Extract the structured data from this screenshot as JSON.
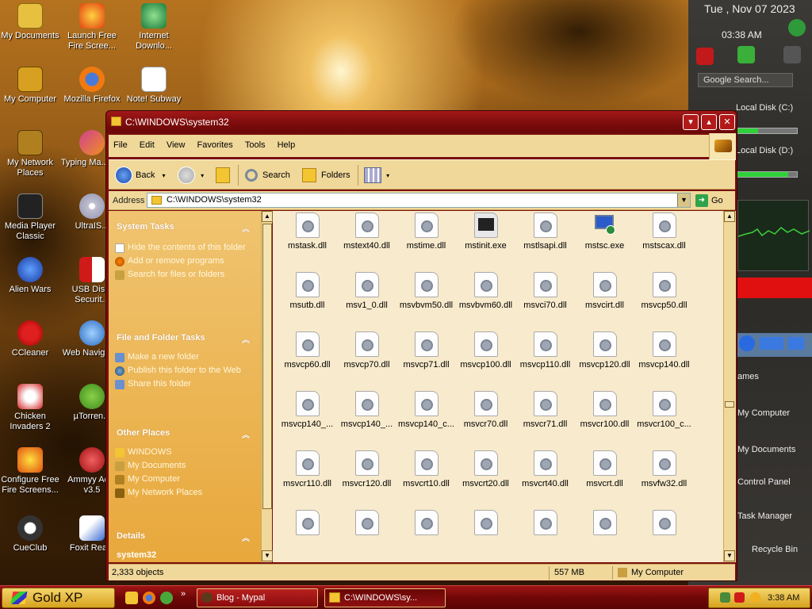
{
  "desktop_icons": [
    {
      "label": "My Documents"
    },
    {
      "label": "Launch Free Fire Scree..."
    },
    {
      "label": "Internet Downlo..."
    },
    {
      "label": "My Computer"
    },
    {
      "label": "Mozilla Firefox"
    },
    {
      "label": "Note! Subway"
    },
    {
      "label": "My Network Places"
    },
    {
      "label": "Typing Ma... 7.0"
    },
    {
      "label": "Media Player Classic"
    },
    {
      "label": "UltraIS..."
    },
    {
      "label": "Alien Wars"
    },
    {
      "label": "USB Dis... Securit..."
    },
    {
      "label": "CCleaner"
    },
    {
      "label": "Web Navigati..."
    },
    {
      "label": "Chicken Invaders 2"
    },
    {
      "label": "µTorren..."
    },
    {
      "label": "Configure Free Fire Screens..."
    },
    {
      "label": "Ammyy Ad... v3.5"
    },
    {
      "label": "CueClub"
    },
    {
      "label": "Foxit Rea..."
    }
  ],
  "gadgets": {
    "date": "Tue , Nov 07 2023",
    "time": "03:38 AM",
    "search_label": "Google Search...",
    "disk_c": "Local Disk (C:)",
    "disk_d": "Local Disk (D:)",
    "disk_c_used": 0.35,
    "disk_d_used": 0.85,
    "links": [
      "ames",
      "My Computer",
      "My Documents",
      "Control Panel",
      "Task Manager"
    ],
    "recycle": "Recycle Bin"
  },
  "window": {
    "title": "C:\\WINDOWS\\system32",
    "menu": [
      "File",
      "Edit",
      "View",
      "Favorites",
      "Tools",
      "Help"
    ],
    "toolbar": {
      "back": "Back",
      "search": "Search",
      "folders": "Folders"
    },
    "address_label": "Address",
    "address_value": "C:\\WINDOWS\\system32",
    "go_label": "Go",
    "tasks": {
      "system_tasks": {
        "title": "System Tasks",
        "items": [
          "Hide the contents of this folder",
          "Add or remove programs",
          "Search for files or folders"
        ]
      },
      "file_folder_tasks": {
        "title": "File and Folder Tasks",
        "items": [
          "Make a new folder",
          "Publish this folder to the Web",
          "Share this folder"
        ]
      },
      "other_places": {
        "title": "Other Places",
        "items": [
          "WINDOWS",
          "My Documents",
          "My Computer",
          "My Network Places"
        ]
      },
      "details": {
        "title": "Details",
        "name": "system32"
      }
    },
    "files": [
      {
        "name": "mstask.dll",
        "type": "dll"
      },
      {
        "name": "mstext40.dll",
        "type": "dll"
      },
      {
        "name": "mstime.dll",
        "type": "dll"
      },
      {
        "name": "mstinit.exe",
        "type": "exe-dark"
      },
      {
        "name": "mstlsapi.dll",
        "type": "dll"
      },
      {
        "name": "mstsc.exe",
        "type": "exe-rdp"
      },
      {
        "name": "mstscax.dll",
        "type": "dll"
      },
      {
        "name": "msutb.dll",
        "type": "dll"
      },
      {
        "name": "msv1_0.dll",
        "type": "dll"
      },
      {
        "name": "msvbvm50.dll",
        "type": "dll"
      },
      {
        "name": "msvbvm60.dll",
        "type": "dll"
      },
      {
        "name": "msvci70.dll",
        "type": "dll"
      },
      {
        "name": "msvcirt.dll",
        "type": "dll"
      },
      {
        "name": "msvcp50.dll",
        "type": "dll"
      },
      {
        "name": "msvcp60.dll",
        "type": "dll"
      },
      {
        "name": "msvcp70.dll",
        "type": "dll"
      },
      {
        "name": "msvcp71.dll",
        "type": "dll"
      },
      {
        "name": "msvcp100.dll",
        "type": "dll"
      },
      {
        "name": "msvcp110.dll",
        "type": "dll"
      },
      {
        "name": "msvcp120.dll",
        "type": "dll"
      },
      {
        "name": "msvcp140.dll",
        "type": "dll"
      },
      {
        "name": "msvcp140_...",
        "type": "dll"
      },
      {
        "name": "msvcp140_...",
        "type": "dll"
      },
      {
        "name": "msvcp140_c...",
        "type": "dll"
      },
      {
        "name": "msvcr70.dll",
        "type": "dll"
      },
      {
        "name": "msvcr71.dll",
        "type": "dll"
      },
      {
        "name": "msvcr100.dll",
        "type": "dll"
      },
      {
        "name": "msvcr100_c...",
        "type": "dll"
      },
      {
        "name": "msvcr110.dll",
        "type": "dll"
      },
      {
        "name": "msvcr120.dll",
        "type": "dll"
      },
      {
        "name": "msvcrt10.dll",
        "type": "dll"
      },
      {
        "name": "msvcrt20.dll",
        "type": "dll"
      },
      {
        "name": "msvcrt40.dll",
        "type": "dll"
      },
      {
        "name": "msvcrt.dll",
        "type": "dll"
      },
      {
        "name": "msvfw32.dll",
        "type": "dll"
      },
      {
        "name": "",
        "type": "dll"
      },
      {
        "name": "",
        "type": "dll"
      },
      {
        "name": "",
        "type": "dll"
      },
      {
        "name": "",
        "type": "dll"
      },
      {
        "name": "",
        "type": "dll"
      },
      {
        "name": "",
        "type": "dll"
      },
      {
        "name": "",
        "type": "dll"
      }
    ],
    "status": {
      "objects": "2,333 objects",
      "size": "557 MB",
      "location": "My Computer"
    }
  },
  "taskbar": {
    "start_label": "Gold XP",
    "tasks": [
      {
        "label": "Blog - Mypal"
      },
      {
        "label": "C:\\WINDOWS\\sy..."
      }
    ],
    "clock": "3:38 AM"
  },
  "colors": {
    "accent": "#7a0c0c",
    "pane": "#e8a83c",
    "file_bg": "#f8eacc"
  }
}
